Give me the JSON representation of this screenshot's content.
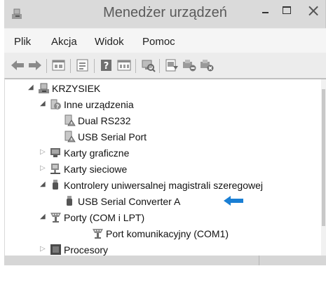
{
  "window": {
    "title": "Menedżer urządzeń"
  },
  "menu": [
    "Plik",
    "Akcja",
    "Widok",
    "Pomoc"
  ],
  "toolbar": {
    "buttons": [
      "back-icon",
      "forward-icon",
      "properties-icon",
      "show-hide-icon",
      "help-icon",
      "view-icon",
      "scan-hardware-icon",
      "update-driver-icon",
      "disable-device-icon",
      "uninstall-device-icon"
    ]
  },
  "tree": {
    "root": "KRZYSIEK",
    "other_devices": "Inne urządzenia",
    "dual_rs232": "Dual RS232",
    "usb_serial_port": "USB Serial Port",
    "display_adapters": "Karty graficzne",
    "network_adapters": "Karty sieciowe",
    "usb_controllers": "Kontrolery uniwersalnej magistrali szeregowej",
    "usb_serial_converter": "USB Serial Converter A",
    "ports": "Porty (COM i LPT)",
    "com_port": "Port komunikacyjny (COM1)",
    "processors": "Procesory"
  },
  "colors": {
    "highlight_arrow": "#1a7fd4",
    "window_chrome": "#dadada",
    "menu_bg": "#f5f5f5"
  }
}
